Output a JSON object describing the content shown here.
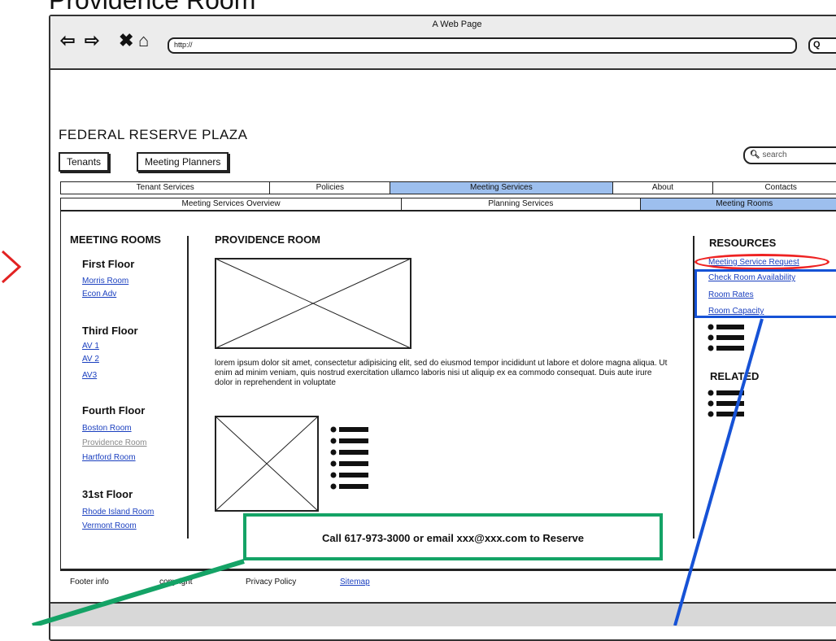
{
  "page_heading": "Providence Room",
  "browser": {
    "window_title": "A Web Page",
    "url": "http://",
    "search_glyph": "Q"
  },
  "site": {
    "title": "FEDERAL RESERVE PLAZA",
    "buttons": [
      "Tenants",
      "Meeting Planners"
    ],
    "search_placeholder": "search"
  },
  "nav": {
    "primary": [
      {
        "label": "Tenant Services",
        "active": false
      },
      {
        "label": "Policies",
        "active": false
      },
      {
        "label": "Meeting Services",
        "active": true
      },
      {
        "label": "About",
        "active": false
      },
      {
        "label": "Contacts",
        "active": false
      }
    ],
    "secondary": [
      {
        "label": "Meeting Services Overview",
        "active": false
      },
      {
        "label": "Planning Services",
        "active": false
      },
      {
        "label": "Meeting Rooms",
        "active": true
      }
    ]
  },
  "sidebar": {
    "title": "MEETING ROOMS",
    "floors": [
      {
        "name": "First Floor",
        "rooms": [
          "Morris Room",
          "Econ Adv"
        ]
      },
      {
        "name": "Third Floor",
        "rooms": [
          "AV 1",
          "AV 2",
          "AV3"
        ]
      },
      {
        "name": "Fourth Floor",
        "rooms": [
          "Boston Room",
          "Providence Room",
          "Hartford Room"
        ]
      },
      {
        "name": "31st Floor",
        "rooms": [
          "Rhode Island Room",
          "Vermont Room"
        ]
      }
    ],
    "current_room": "Providence Room"
  },
  "main": {
    "title": "PROVIDENCE ROOM",
    "body": "lorem ipsum dolor sit amet, consectetur adipisicing elit, sed do eiusmod tempor incididunt ut labore et dolore magna aliqua. Ut enim ad minim veniam, quis nostrud exercitation ullamco laboris nisi ut aliquip ex ea commodo consequat. Duis aute irure dolor in reprehendent in voluptate"
  },
  "resources": {
    "title": "RESOURCES",
    "links": [
      "Meeting Service Request",
      "Check Room Availability",
      "Room Rates",
      "Room Capacity"
    ],
    "related_title": "RELATED"
  },
  "footer": {
    "items": [
      "Footer info",
      "copyright",
      "Privacy Policy",
      "Sitemap"
    ]
  },
  "callout": {
    "text": "Call 617-973-3000 or email xxx@xxx.com to Reserve"
  },
  "colors": {
    "active_tab": "#9dbfee",
    "link": "#1a3fbf",
    "green_annotation": "#14a366",
    "red_annotation": "#e22222",
    "blue_annotation": "#1652d6"
  },
  "icons": [
    "back-arrow-icon",
    "forward-arrow-icon",
    "close-x-icon",
    "home-icon",
    "search-icon",
    "bullet-list-icon",
    "image-placeholder-icon"
  ]
}
